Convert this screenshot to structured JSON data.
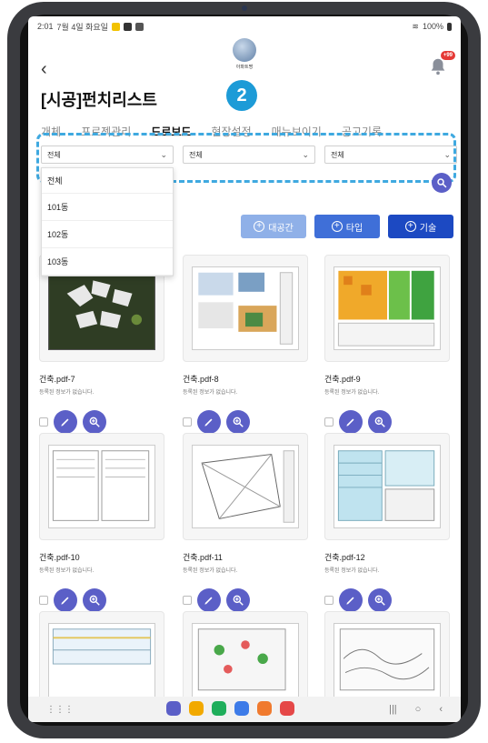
{
  "status_bar": {
    "time": "2:01",
    "date": "7월 4일 화요일",
    "battery": "100%"
  },
  "header": {
    "logo_caption": "아파트명",
    "notification_badge": "+99"
  },
  "page_title": "[시공]펀치리스트",
  "step_badge": "2",
  "tabs": [
    {
      "label": "개체"
    },
    {
      "label": "프로젝관리"
    },
    {
      "label": "드로보드"
    },
    {
      "label": "현장설정"
    },
    {
      "label": "매뉴보이기"
    },
    {
      "label": "공고기록"
    }
  ],
  "filters": [
    {
      "value": "전체"
    },
    {
      "value": "전체"
    },
    {
      "value": "전체"
    }
  ],
  "dropdown": {
    "options": [
      "전체",
      "101동",
      "102동",
      "103동"
    ]
  },
  "actions": {
    "space": "대공간",
    "type": "타입",
    "tech": "기술"
  },
  "cards": [
    {
      "name": "건축.pdf-7",
      "info": "등록된 정보가 없습니다."
    },
    {
      "name": "건축.pdf-8",
      "info": "등록된 정보가 없습니다."
    },
    {
      "name": "건축.pdf-9",
      "info": "등록된 정보가 없습니다."
    },
    {
      "name": "건축.pdf-10",
      "info": "등록된 정보가 없습니다."
    },
    {
      "name": "건축.pdf-11",
      "info": "등록된 정보가 없습니다."
    },
    {
      "name": "건축.pdf-12",
      "info": "등록된 정보가 없습니다."
    }
  ],
  "colors": {
    "accent": "#5b5fc7",
    "highlight": "#3fa9e0",
    "step_badge": "#1d9bd7"
  },
  "icons": [
    "back-chevron-icon",
    "bell-icon",
    "search-icon",
    "chevron-down-icon",
    "plus-circle-icon",
    "pencil-icon",
    "zoom-icon"
  ]
}
